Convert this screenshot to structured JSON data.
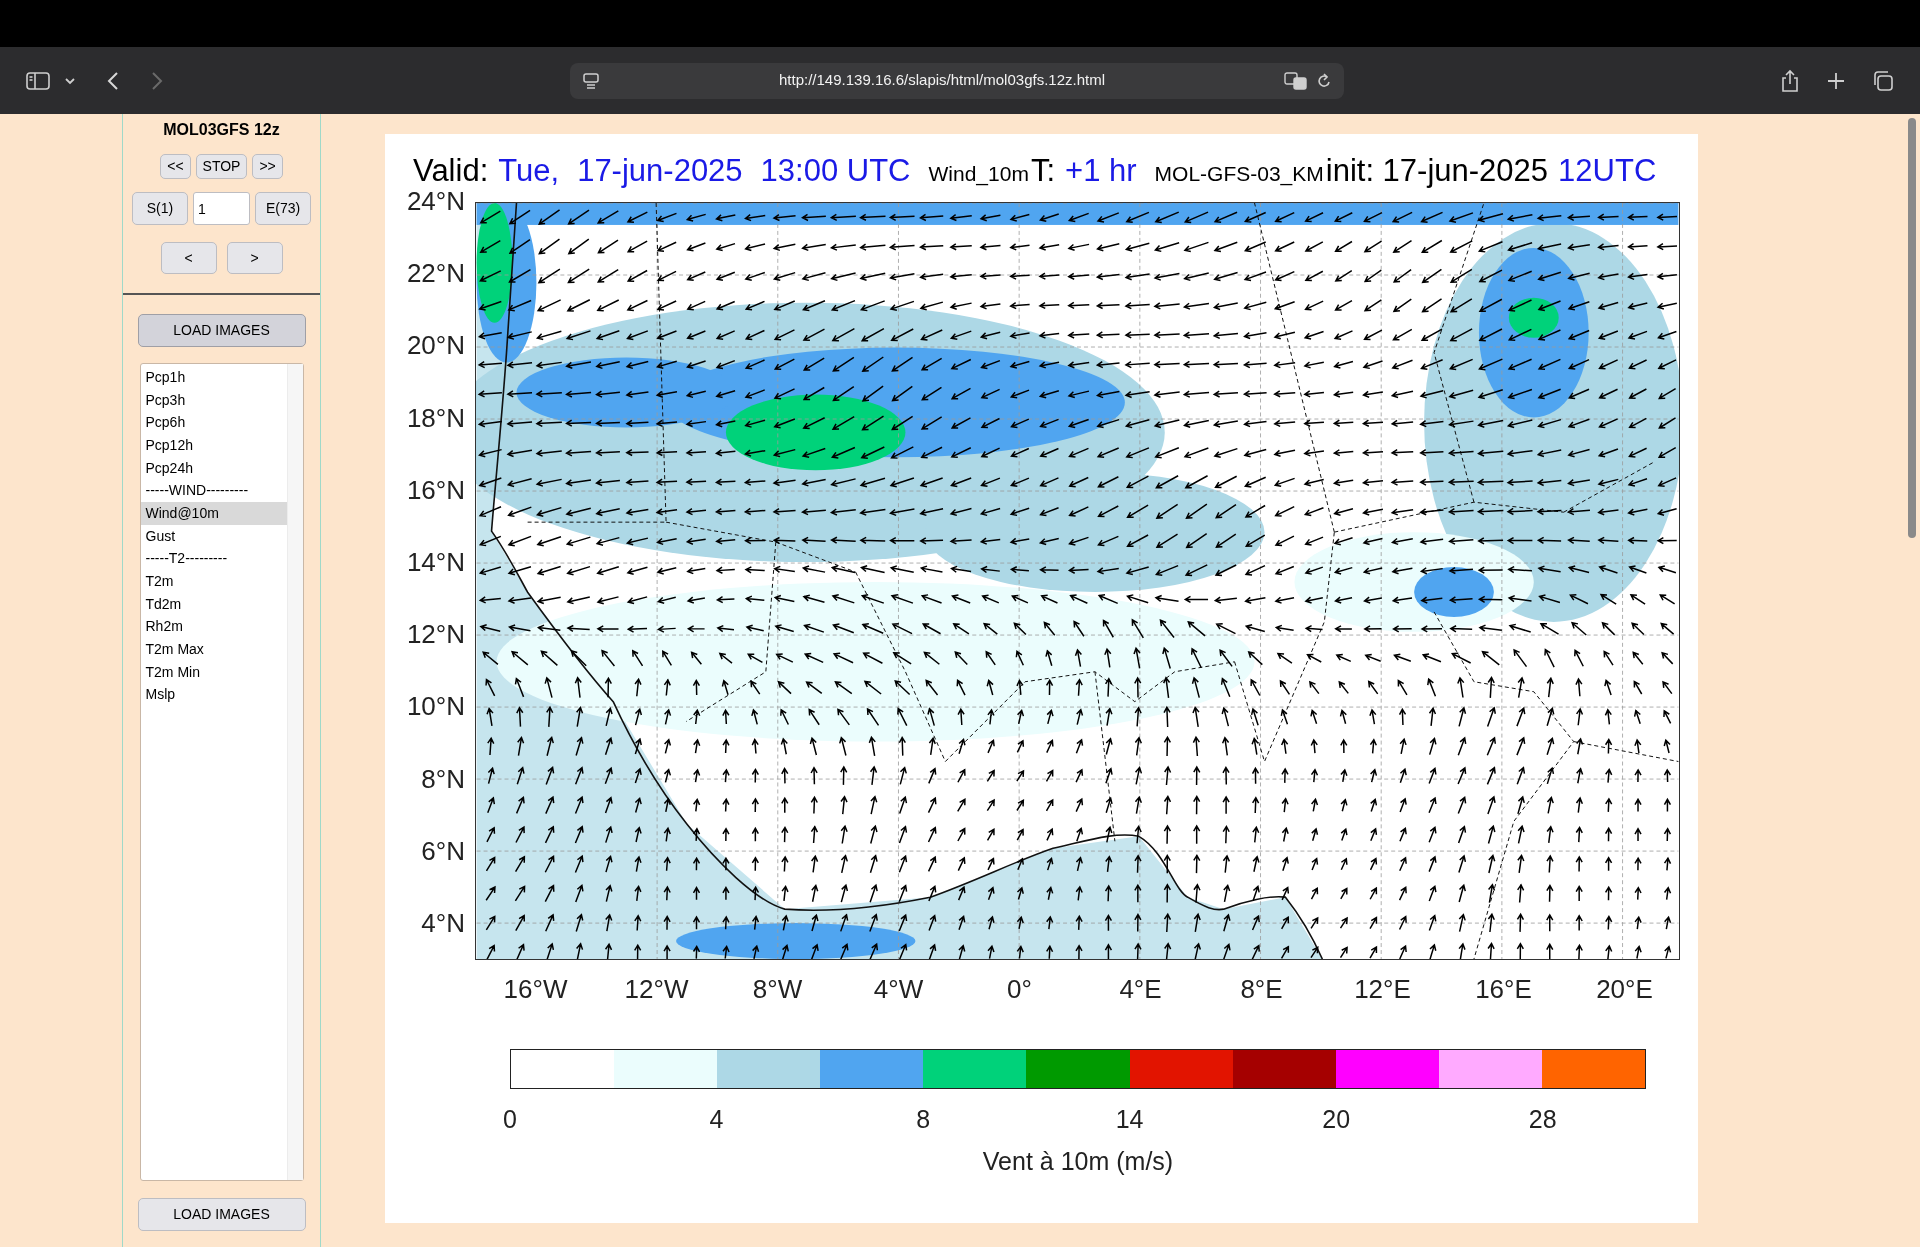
{
  "browser": {
    "url": "http://149.139.16.6/slapis/html/mol03gfs.12z.html",
    "back": {
      "disabled": false
    },
    "forward": {
      "disabled": true
    }
  },
  "sidebar": {
    "title": "MOL03GFS 12z",
    "play_buttons": [
      "<<",
      "STOP",
      ">>"
    ],
    "start_button": "S(1)",
    "frame_value": "1",
    "end_button": "E(73)",
    "step_buttons": [
      "<",
      ">"
    ],
    "load_button_top": "LOAD IMAGES",
    "load_button_bottom": "LOAD IMAGES",
    "products": [
      {
        "label": "Pcp1h",
        "selected": false
      },
      {
        "label": "Pcp3h",
        "selected": false
      },
      {
        "label": "Pcp6h",
        "selected": false
      },
      {
        "label": "Pcp12h",
        "selected": false
      },
      {
        "label": "Pcp24h",
        "selected": false
      },
      {
        "label": "-----WIND---------",
        "selected": false
      },
      {
        "label": "Wind@10m",
        "selected": true
      },
      {
        "label": "Gust",
        "selected": false
      },
      {
        "label": "-----T2---------",
        "selected": false
      },
      {
        "label": "T2m",
        "selected": false
      },
      {
        "label": "Td2m",
        "selected": false
      },
      {
        "label": "Rh2m",
        "selected": false
      },
      {
        "label": "T2m Max",
        "selected": false
      },
      {
        "label": "T2m Min",
        "selected": false
      },
      {
        "label": "Mslp",
        "selected": false
      }
    ]
  },
  "map": {
    "header": [
      {
        "kind": "label",
        "text": "Valid:"
      },
      {
        "kind": "value",
        "text": "Tue,"
      },
      {
        "kind": "value",
        "text": "17-jun-2025"
      },
      {
        "kind": "value",
        "text": "13:00 UTC"
      },
      {
        "kind": "small",
        "text": "Wind_10m"
      },
      {
        "kind": "label",
        "text": "T:"
      },
      {
        "kind": "value",
        "text": "+1 hr"
      },
      {
        "kind": "small",
        "text": "MOL-GFS-03_KM"
      },
      {
        "kind": "label",
        "text": "init: 17-jun-2025"
      },
      {
        "kind": "value",
        "text": "12UTC"
      }
    ],
    "lat_labels": [
      "24°N",
      "22°N",
      "20°N",
      "18°N",
      "16°N",
      "14°N",
      "12°N",
      "10°N",
      "8°N",
      "6°N",
      "4°N"
    ],
    "lon_labels": [
      "16°W",
      "12°W",
      "8°W",
      "4°W",
      "0°",
      "4°E",
      "8°E",
      "12°E",
      "16°E",
      "20°E"
    ],
    "legend": {
      "bins": [
        {
          "color": "#ffffff"
        },
        {
          "color": "#ebfdfd"
        },
        {
          "color": "#add8e6"
        },
        {
          "color": "#50a5f0"
        },
        {
          "color": "#00d27a"
        },
        {
          "color": "#009a00"
        },
        {
          "color": "#e21400"
        },
        {
          "color": "#a50000"
        },
        {
          "color": "#ff00ff"
        },
        {
          "color": "#ffaaff"
        },
        {
          "color": "#ff6400"
        }
      ],
      "ticks": [
        "0",
        "4",
        "8",
        "14",
        "20",
        "28"
      ],
      "title": "Vent à 10m (m/s)"
    }
  }
}
